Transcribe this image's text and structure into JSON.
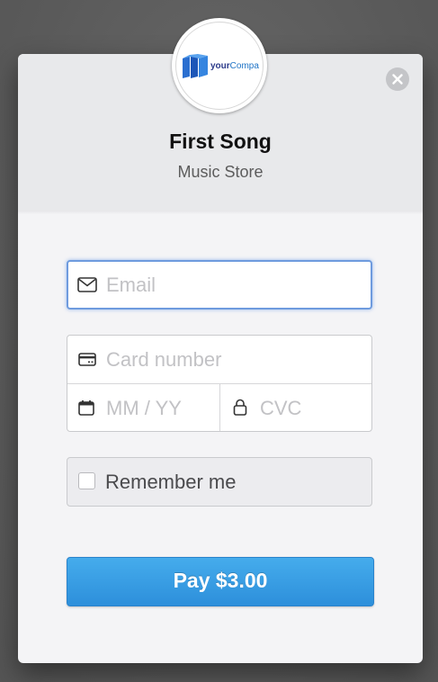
{
  "merchant": {
    "logo_text_part1": "your",
    "logo_text_part2": "Compa",
    "name": "First Song",
    "description": "Music Store"
  },
  "close": {
    "icon": "close-icon"
  },
  "email": {
    "placeholder": "Email",
    "icon": "mail-icon"
  },
  "card": {
    "number_placeholder": "Card number",
    "number_icon": "credit-card-icon",
    "expiry_placeholder": "MM / YY",
    "expiry_icon": "calendar-icon",
    "cvc_placeholder": "CVC",
    "cvc_icon": "lock-icon"
  },
  "remember": {
    "label": "Remember me",
    "checked": false
  },
  "pay": {
    "label": "Pay $3.00"
  },
  "colors": {
    "accent": "#3a9fe6",
    "focus_border": "#6e9bde",
    "header_bg": "#e8e9eb",
    "body_bg": "#f4f4f6"
  }
}
